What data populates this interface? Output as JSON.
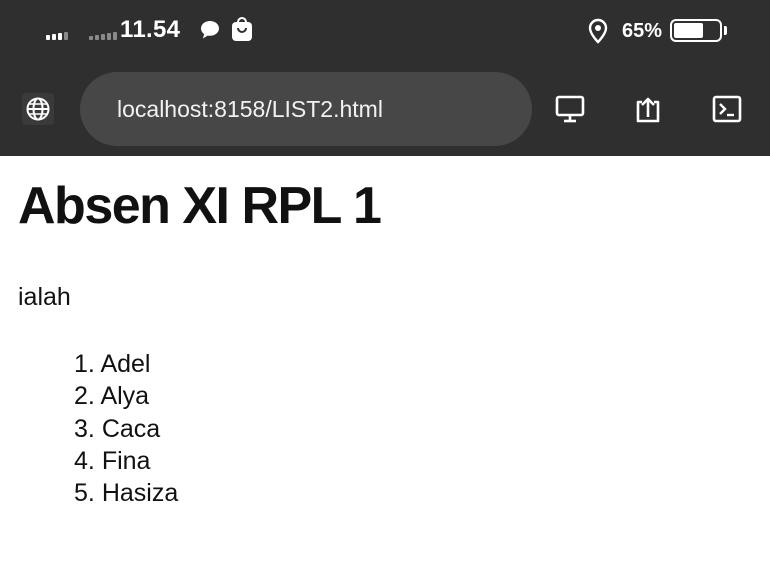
{
  "status_bar": {
    "time": "11.54",
    "battery_percent_label": "65%",
    "battery_level": 0.65,
    "icons": [
      "signal-icon",
      "signal-icon",
      "chat-icon",
      "shopping-bag-icon",
      "location-icon",
      "battery-icon"
    ]
  },
  "browser": {
    "url": "localhost:8158/LIST2.html",
    "icons": [
      "globe-icon",
      "desktop-icon",
      "share-icon",
      "terminal-icon"
    ]
  },
  "page": {
    "title": "Absen XI RPL 1",
    "intro": "ialah",
    "list": [
      {
        "marker": "1.",
        "name": "Adel"
      },
      {
        "marker": "2.",
        "name": "Alya"
      },
      {
        "marker": "3.",
        "name": "Caca"
      },
      {
        "marker": "4.",
        "name": "Fina"
      },
      {
        "marker": "5.",
        "name": "Hasiza"
      }
    ]
  },
  "colors": {
    "toolbar_bg": "#2f2f2f",
    "urlbar_bg": "#474747",
    "page_bg": "#ffffff",
    "text": "#111111"
  }
}
